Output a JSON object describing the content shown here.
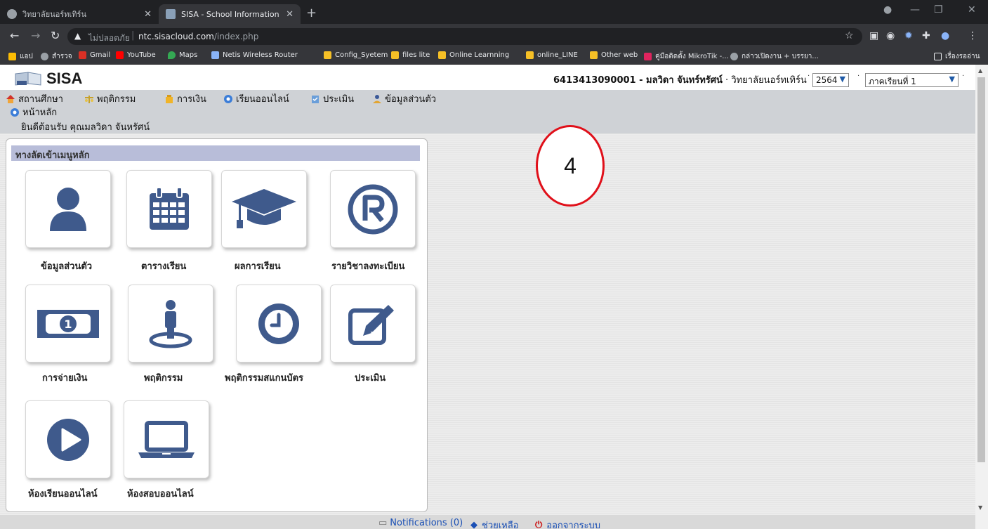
{
  "browser": {
    "tabs": [
      {
        "title": "วิทยาลัยนอร์ทเทิร์น",
        "active": false
      },
      {
        "title": "SISA - School Information Systen",
        "active": true
      }
    ],
    "warning": "ไม่ปลอดภัย",
    "url_host": "ntc.sisacloud.com",
    "url_path": "/index.php",
    "bookmarks": [
      "แอป",
      "สำรวจ",
      "Gmail",
      "YouTube",
      "Maps",
      "Netis Wireless Router",
      "Config_Syetem",
      "files lite",
      "Online Learnning",
      "online_LINE",
      "Other web",
      "คู่มือติดตั้ง MikroTik -...",
      "กล่าวเปิดงาน + บรรยา..."
    ],
    "reading_list": "เรื่องรออ่าน"
  },
  "header": {
    "logo": "SISA",
    "user_id": "6413413090001",
    "user_name": "มลวิดา จันทร์ทรัศน์",
    "college": "วิทยาลัยนอร์ทเทิร์น",
    "year": "2564",
    "term": "ภาคเรียนที่ 1",
    "home": "หน้าหลัก",
    "welcome": "ยินดีต้อนรับ คุณมลวิดา จันหรัศน์"
  },
  "menu": [
    "สถานศึกษา",
    "พฤติกรรม",
    "การเงิน",
    "เรียนออนไลน์",
    "ประเมิน",
    "ข้อมูลส่วนตัว"
  ],
  "panel": {
    "title": "ทางลัดเข้าเมนูหลัก",
    "tiles": [
      {
        "label": "ข้อมูลส่วนตัว",
        "icon": "user-icon"
      },
      {
        "label": "ตารางเรียน",
        "icon": "calendar-icon"
      },
      {
        "label": "ผลการเรียน",
        "icon": "graduation-cap-icon"
      },
      {
        "label": "รายวิชาลงทะเบียน",
        "icon": "registered-icon"
      },
      {
        "label": "การจ่ายเงิน",
        "icon": "money-bill-icon"
      },
      {
        "label": "พฤติกรรม",
        "icon": "person-pin-icon"
      },
      {
        "label": "พฤติกรรมสแกนบัตร",
        "icon": "clock-icon"
      },
      {
        "label": "ประเมิน",
        "icon": "edit-icon"
      },
      {
        "label": "ห้องเรียนออนไลน์",
        "icon": "play-icon"
      },
      {
        "label": "ห้องสอบออนไลน์",
        "icon": "laptop-icon"
      }
    ]
  },
  "annotation": "4",
  "footer": {
    "notifications": "Notifications (0)",
    "help": "ช่วยเหลือ",
    "logout": "ออกจากระบบ"
  },
  "colors": {
    "icon_blue": "#3f5a8c",
    "panel_title_bg": "#b8bdd9",
    "annotation_red": "#e0101a",
    "logout_red": "#cc1111",
    "link_blue": "#1b50b5"
  }
}
